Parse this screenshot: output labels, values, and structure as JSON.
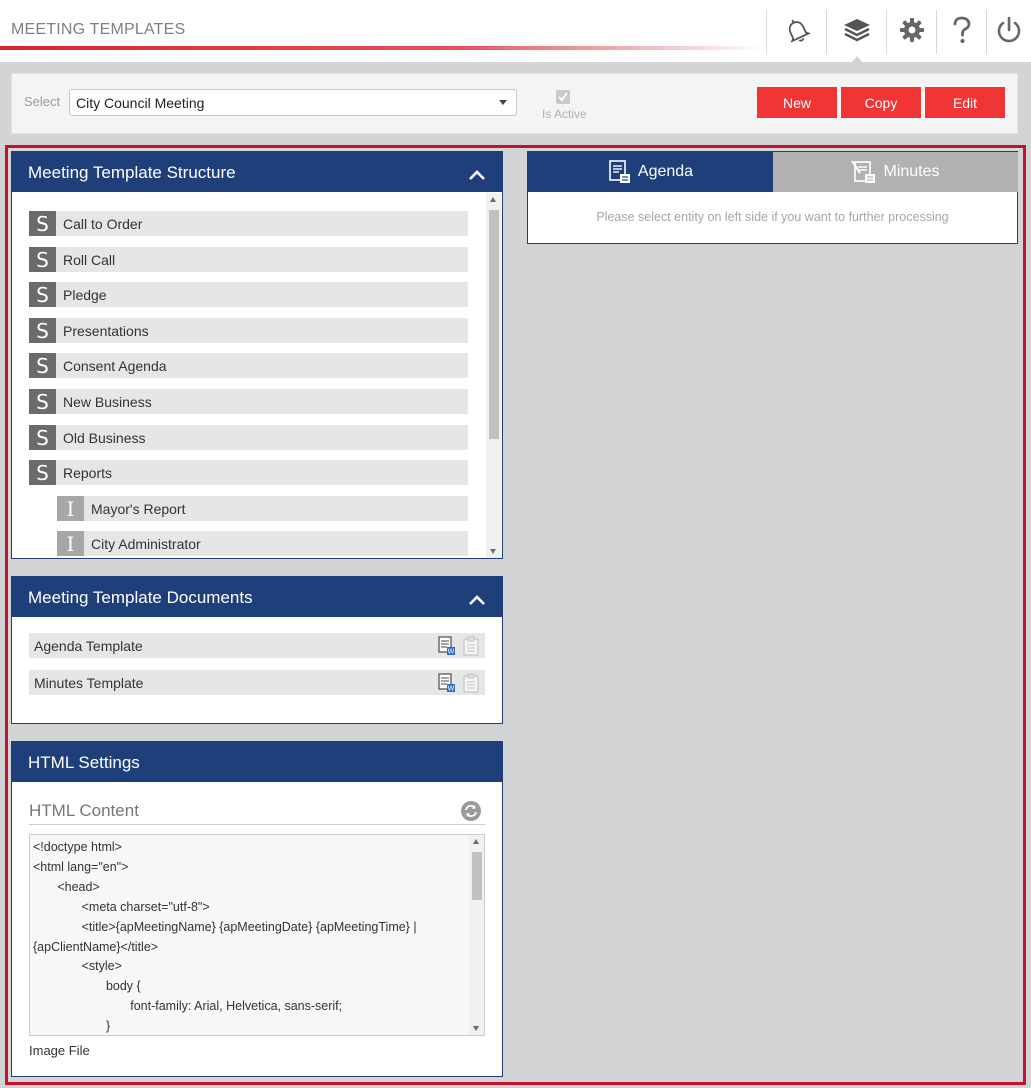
{
  "header": {
    "title": "MEETING TEMPLATES",
    "icons": [
      "bell-icon",
      "layers-icon",
      "gear-icon",
      "help-icon",
      "power-icon"
    ],
    "accent_color": "#d9232e"
  },
  "select_bar": {
    "label": "Select",
    "selected_value": "City Council Meeting",
    "is_active_label": "Is Active",
    "is_active_checked": true,
    "buttons": {
      "new": "New",
      "copy": "Copy",
      "edit": "Edit"
    },
    "button_color": "#ef3535"
  },
  "structure_panel": {
    "title": "Meeting Template Structure",
    "items": [
      {
        "badge": "S",
        "label": "Call to Order",
        "type": "section"
      },
      {
        "badge": "S",
        "label": "Roll Call",
        "type": "section"
      },
      {
        "badge": "S",
        "label": "Pledge",
        "type": "section"
      },
      {
        "badge": "S",
        "label": "Presentations",
        "type": "section"
      },
      {
        "badge": "S",
        "label": "Consent Agenda",
        "type": "section"
      },
      {
        "badge": "S",
        "label": "New Business",
        "type": "section"
      },
      {
        "badge": "S",
        "label": "Old Business",
        "type": "section"
      },
      {
        "badge": "S",
        "label": "Reports",
        "type": "section"
      },
      {
        "badge": "I",
        "label": "Mayor's Report",
        "type": "item"
      },
      {
        "badge": "I",
        "label": "City Administrator",
        "type": "item"
      }
    ]
  },
  "documents_panel": {
    "title": "Meeting Template Documents",
    "items": [
      {
        "label": "Agenda Template"
      },
      {
        "label": "Minutes Template"
      }
    ]
  },
  "html_settings_panel": {
    "title": "HTML Settings",
    "content_label": "HTML Content",
    "code": "<!doctype html>\n<html lang=\"en\">\n\t<head>\n\t\t<meta charset=\"utf-8\">\n\t\t<title>{apMeetingName} {apMeetingDate} {apMeetingTime} | {apClientName}</title>\n\t\t<style>\n\t\t\tbody {\n\t\t\t\tfont-family: Arial, Helvetica, sans-serif;\n\t\t\t}\n\t\t\t.text {",
    "image_file_label": "Image File"
  },
  "tabs": {
    "agenda": "Agenda",
    "minutes": "Minutes",
    "active": "agenda",
    "message": "Please select entity on left side if you want to further processing"
  },
  "theme": {
    "panel_header": "#1f3f7a",
    "frame_border": "#c4122e"
  }
}
